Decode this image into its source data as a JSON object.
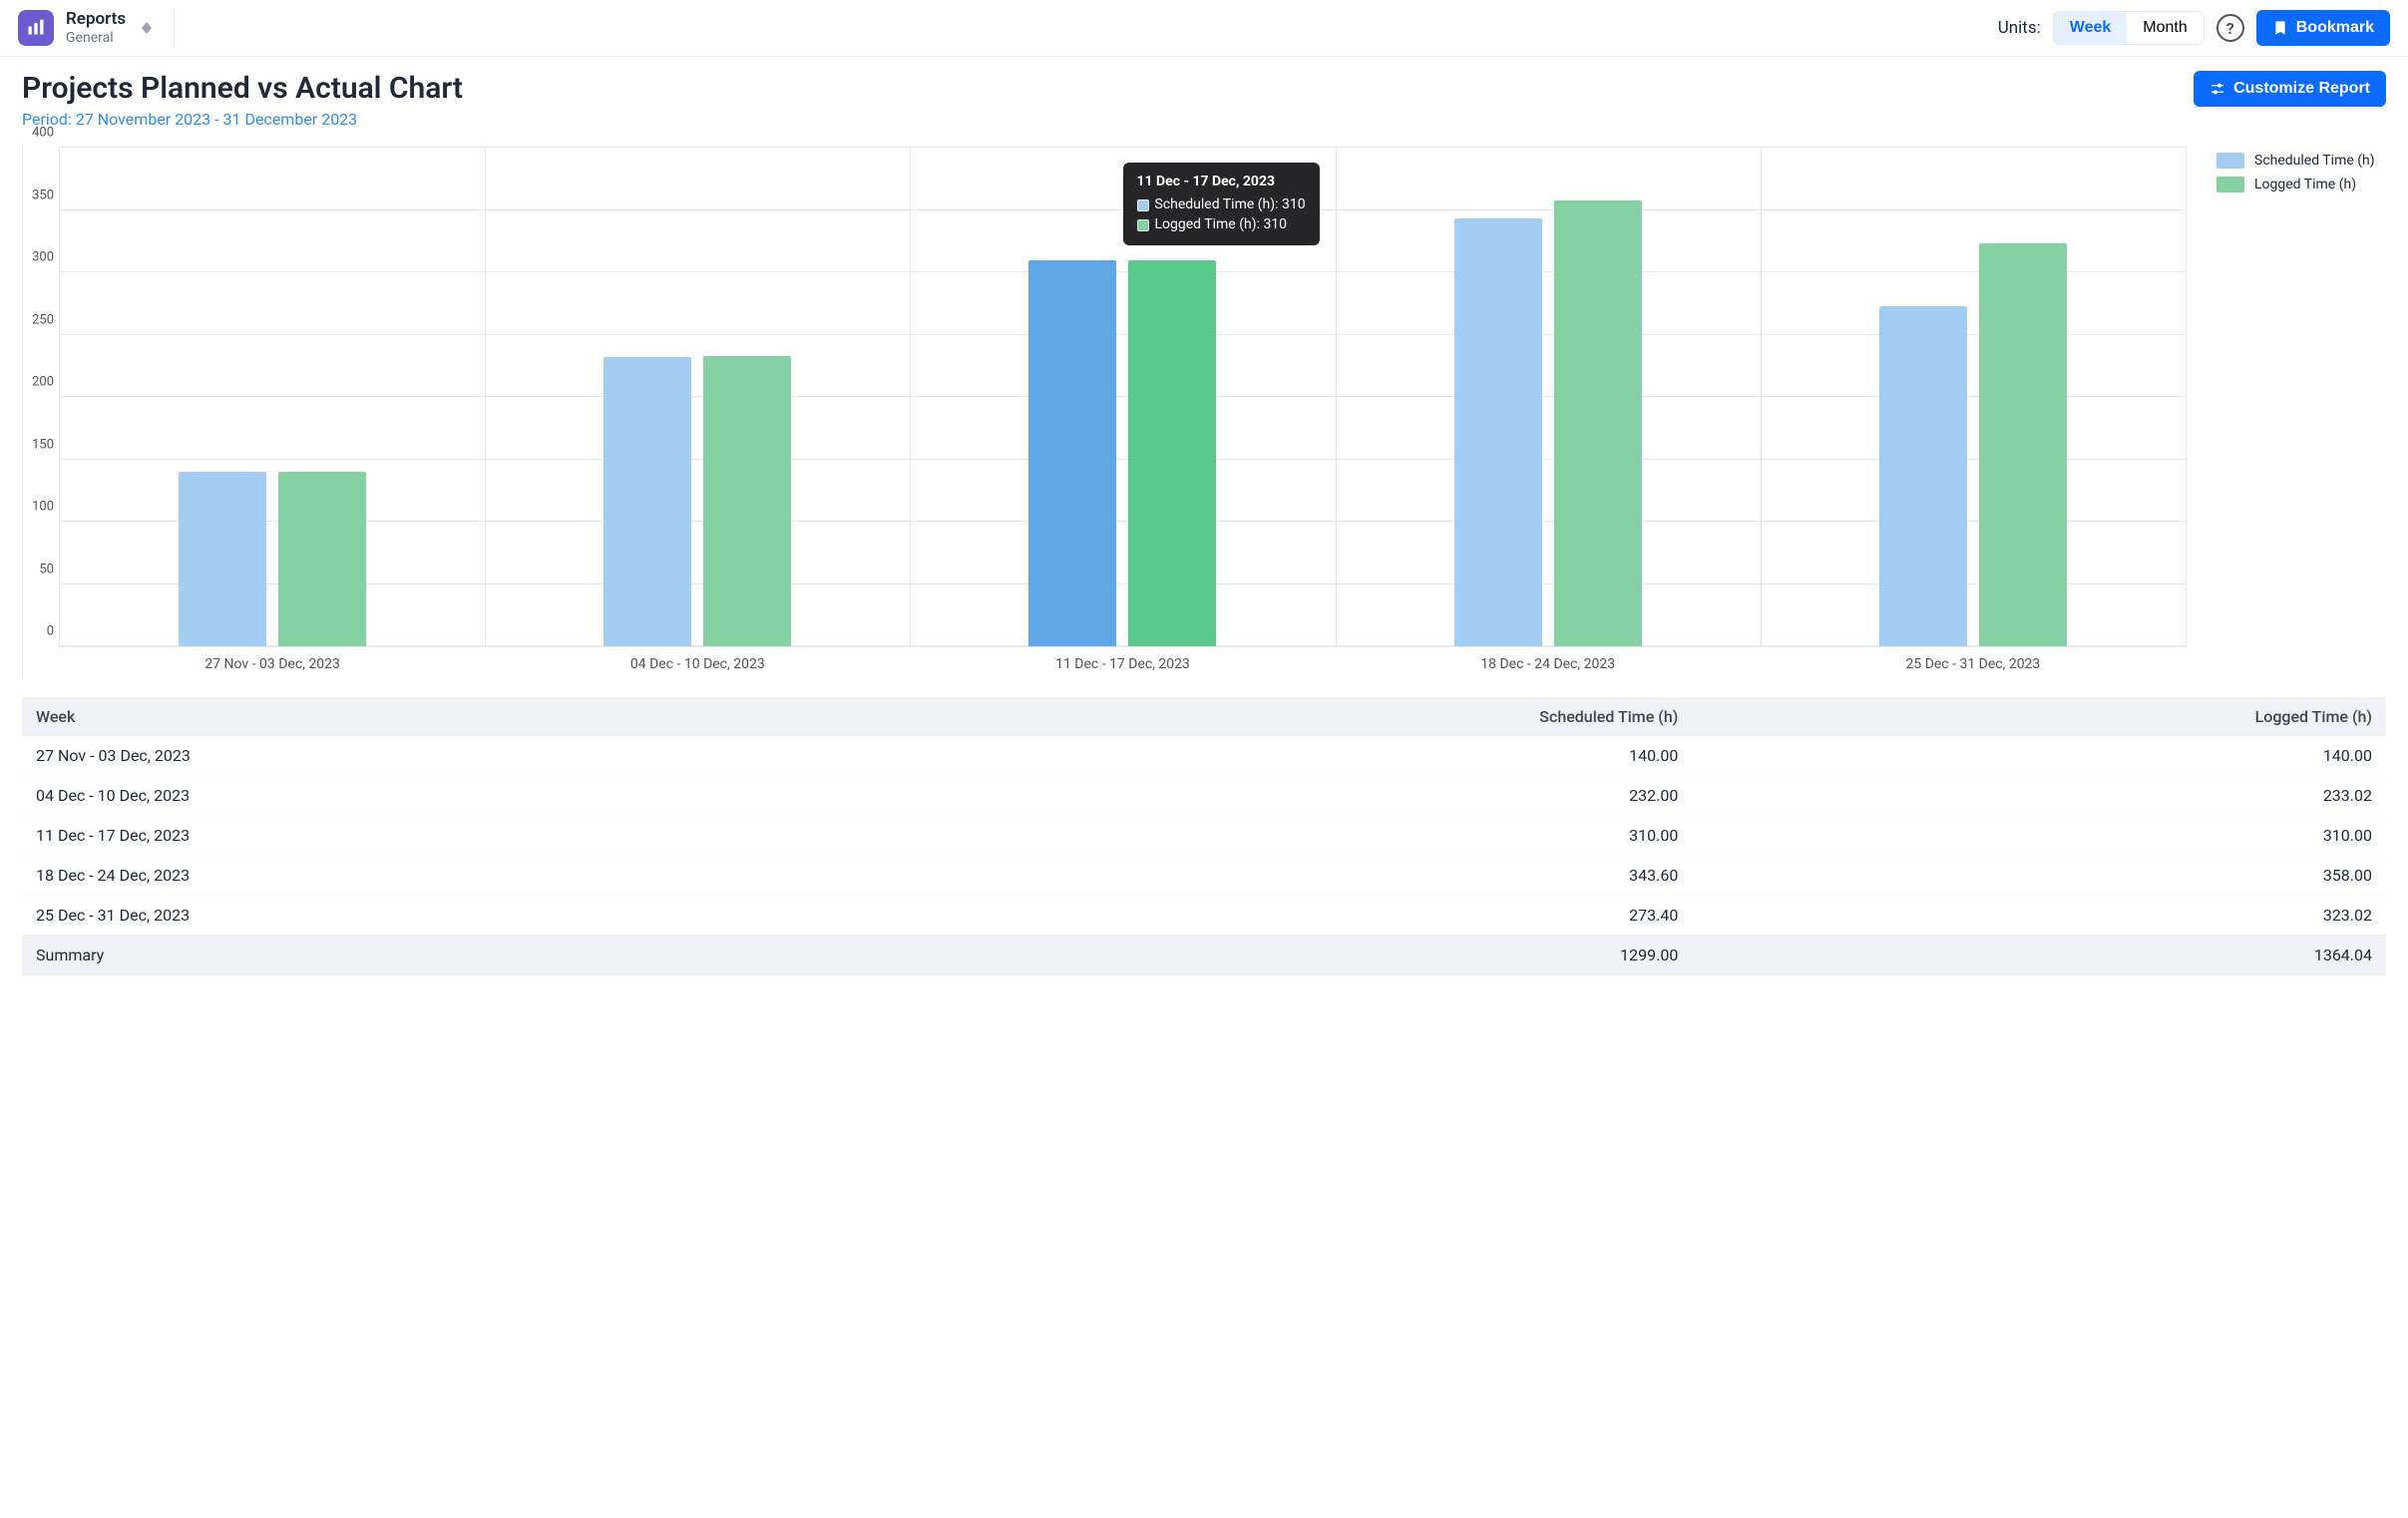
{
  "header": {
    "app_title": "Reports",
    "app_sub": "General",
    "units_label": "Units:",
    "unit_week": "Week",
    "unit_month": "Month",
    "bookmark": "Bookmark"
  },
  "title": "Projects Planned vs Actual Chart",
  "period_prefix": "Period: ",
  "period": "27 November 2023 - 31 December 2023",
  "customize": "Customize Report",
  "legend": {
    "scheduled": "Scheduled Time (h)",
    "logged": "Logged Time (h)"
  },
  "colors": {
    "scheduled": "#a4cdf4",
    "logged": "#86d1a4",
    "scheduled_hover": "#5fa7e7",
    "logged_hover": "#5ac98c",
    "accent": "#0b6bff"
  },
  "chart_data": {
    "type": "bar",
    "categories": [
      "27 Nov - 03 Dec, 2023",
      "04 Dec - 10 Dec, 2023",
      "11 Dec - 17 Dec, 2023",
      "18 Dec - 24 Dec, 2023",
      "25 Dec - 31 Dec, 2023"
    ],
    "series": [
      {
        "name": "Scheduled Time (h)",
        "values": [
          140,
          232,
          310,
          343,
          273
        ]
      },
      {
        "name": "Logged Time (h)",
        "values": [
          140,
          233,
          310,
          358,
          323
        ]
      }
    ],
    "title": "Projects Planned vs Actual Chart",
    "xlabel": "",
    "ylabel": "",
    "ylim": [
      0,
      400
    ],
    "yticks": [
      0,
      50,
      100,
      150,
      200,
      250,
      300,
      350,
      400
    ]
  },
  "tooltip": {
    "title": "11 Dec - 17 Dec, 2023",
    "line1": "Scheduled Time (h): 310",
    "line2": "Logged Time (h): 310",
    "over_index": 2
  },
  "table": {
    "col1": "Week",
    "col2": "Scheduled Time (h)",
    "col3": "Logged Time (h)",
    "rows": [
      {
        "week": "27 Nov - 03 Dec, 2023",
        "scheduled": "140.00",
        "logged": "140.00"
      },
      {
        "week": "04 Dec - 10 Dec, 2023",
        "scheduled": "232.00",
        "logged": "233.02"
      },
      {
        "week": "11 Dec - 17 Dec, 2023",
        "scheduled": "310.00",
        "logged": "310.00"
      },
      {
        "week": "18 Dec - 24 Dec, 2023",
        "scheduled": "343.60",
        "logged": "358.00"
      },
      {
        "week": "25 Dec - 31 Dec, 2023",
        "scheduled": "273.40",
        "logged": "323.02"
      }
    ],
    "summary_label": "Summary",
    "summary_scheduled": "1299.00",
    "summary_logged": "1364.04"
  }
}
